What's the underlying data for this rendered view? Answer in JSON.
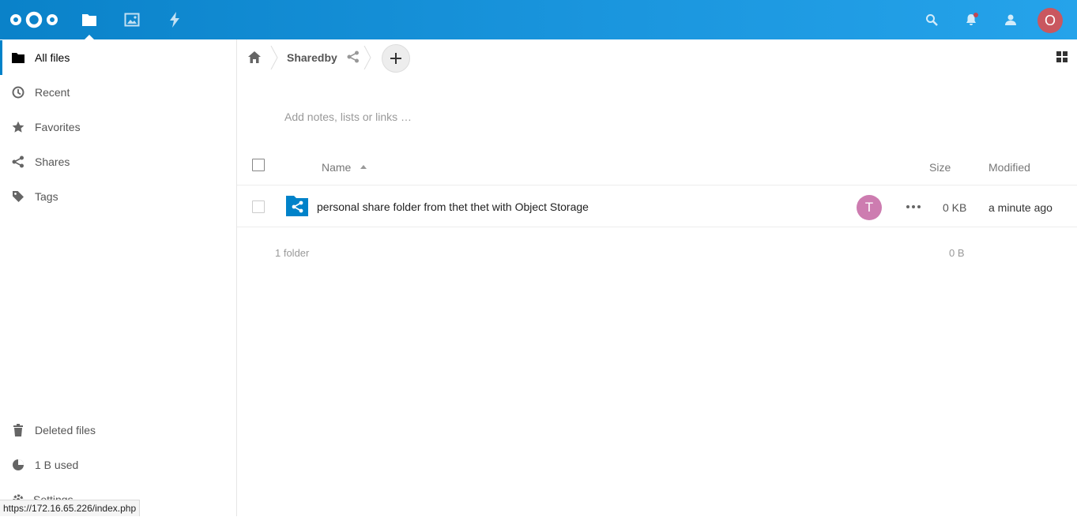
{
  "header": {
    "apps": [
      {
        "name": "Files",
        "icon": "folder-icon"
      },
      {
        "name": "Photos",
        "icon": "image-icon"
      },
      {
        "name": "Activity",
        "icon": "lightning-icon"
      }
    ],
    "avatar_initial": "O",
    "colors": {
      "bar": "#0a82c9",
      "avatar": "#c9575f",
      "notification": "#e9322d"
    }
  },
  "sidebar": {
    "items": [
      {
        "label": "All files",
        "icon": "folder-icon",
        "active": true
      },
      {
        "label": "Recent",
        "icon": "clock-icon"
      },
      {
        "label": "Favorites",
        "icon": "star-icon"
      },
      {
        "label": "Shares",
        "icon": "share-icon"
      },
      {
        "label": "Tags",
        "icon": "tag-icon"
      }
    ],
    "bottom": {
      "deleted": "Deleted files",
      "quota": "1 B used",
      "settings": "Settings"
    }
  },
  "breadcrumb": {
    "folder": "Sharedby"
  },
  "notes_placeholder": "Add notes, lists or links …",
  "table": {
    "columns": {
      "name": "Name",
      "size": "Size",
      "modified": "Modified"
    },
    "rows": [
      {
        "name": "personal share folder from thet thet with Object Storage",
        "owner_initial": "T",
        "size": "0 KB",
        "modified": "a minute ago"
      }
    ],
    "summary": {
      "count": "1 folder",
      "size": "0 B"
    }
  },
  "status_bar_url": "https://172.16.65.226/index.php"
}
